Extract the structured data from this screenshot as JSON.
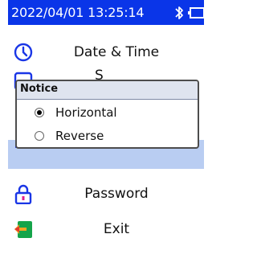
{
  "status_bar": {
    "time": "2022/04/01 13:25:14",
    "bluetooth_icon": "bluetooth-icon",
    "battery_icon": "battery-icon",
    "background_color": "#0a35e8"
  },
  "menu": {
    "items": [
      {
        "label": "Date & Time",
        "icon": "clock-icon"
      },
      {
        "label": "S",
        "icon": "display-icon"
      },
      {
        "label": "",
        "icon": "rotation-icon",
        "selected": true
      },
      {
        "label": "Password",
        "icon": "lock-icon"
      },
      {
        "label": "Exit",
        "icon": "exit-icon"
      }
    ],
    "selected_color": "#b9cdf2"
  },
  "dialog": {
    "title": "Notice",
    "options": [
      {
        "label": "Horizontal",
        "checked": true
      },
      {
        "label": "Reverse",
        "checked": false
      }
    ]
  }
}
